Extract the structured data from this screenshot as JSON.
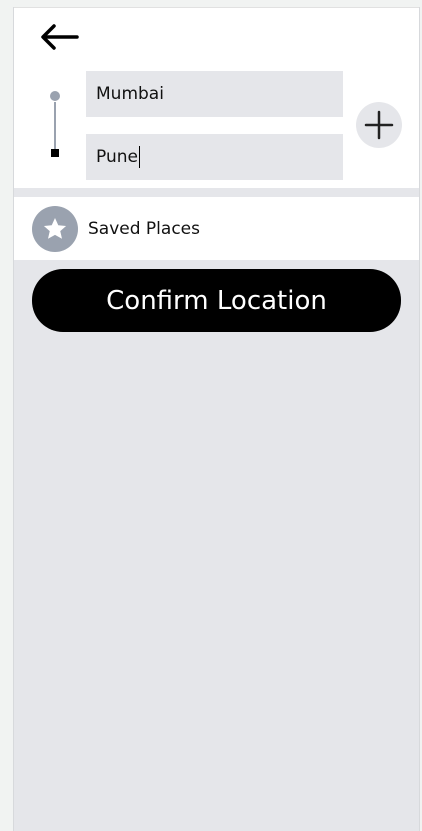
{
  "navigation": {
    "back_icon": "arrow-left-icon"
  },
  "route": {
    "origin_value": "Mumbai",
    "destination_value": "Pune",
    "add_stop_icon": "plus-icon"
  },
  "saved_places": {
    "label": "Saved Places",
    "icon": "star-icon"
  },
  "actions": {
    "confirm_label": "Confirm Location"
  },
  "colors": {
    "background": "#e5e6ea",
    "card": "#ffffff",
    "muted_icon": "#9aa2af",
    "primary": "#000000",
    "primary_text": "#ffffff"
  }
}
